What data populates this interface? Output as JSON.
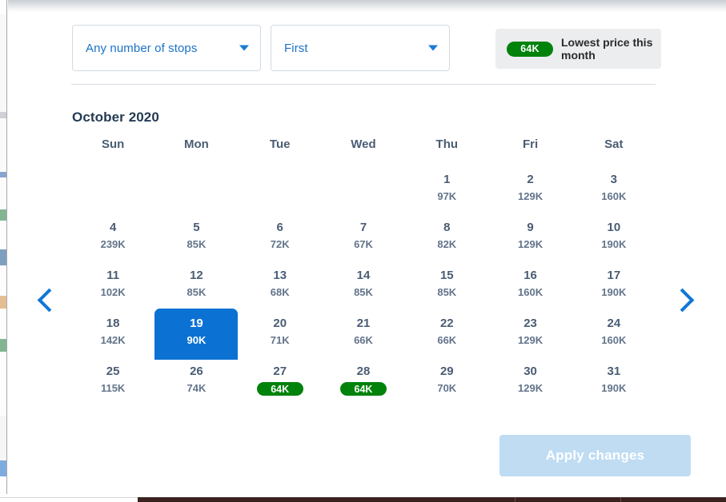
{
  "filters": {
    "stops": {
      "value": "Any number of stops",
      "caret_icon": "caret-down-icon"
    },
    "cabin": {
      "value": "First",
      "caret_icon": "caret-down-icon"
    }
  },
  "lowest_price": {
    "badge": "64K",
    "label": "Lowest price this month",
    "badge_color": "#00820b"
  },
  "calendar": {
    "month_title": "October 2020",
    "weekdays": [
      "Sun",
      "Mon",
      "Tue",
      "Wed",
      "Thu",
      "Fri",
      "Sat"
    ],
    "prev_icon": "chevron-left-icon",
    "next_icon": "chevron-right-icon",
    "selected_day": 19,
    "selected_color": "#0b72d4",
    "weeks": [
      [
        {
          "day": "",
          "price": "",
          "empty": true
        },
        {
          "day": "",
          "price": "",
          "empty": true
        },
        {
          "day": "",
          "price": "",
          "empty": true
        },
        {
          "day": "",
          "price": "",
          "empty": true
        },
        {
          "day": "1",
          "price": "97K"
        },
        {
          "day": "2",
          "price": "129K"
        },
        {
          "day": "3",
          "price": "160K"
        }
      ],
      [
        {
          "day": "4",
          "price": "239K"
        },
        {
          "day": "5",
          "price": "85K"
        },
        {
          "day": "6",
          "price": "72K"
        },
        {
          "day": "7",
          "price": "67K"
        },
        {
          "day": "8",
          "price": "82K"
        },
        {
          "day": "9",
          "price": "129K"
        },
        {
          "day": "10",
          "price": "190K"
        }
      ],
      [
        {
          "day": "11",
          "price": "102K"
        },
        {
          "day": "12",
          "price": "85K"
        },
        {
          "day": "13",
          "price": "68K"
        },
        {
          "day": "14",
          "price": "85K"
        },
        {
          "day": "15",
          "price": "85K"
        },
        {
          "day": "16",
          "price": "160K"
        },
        {
          "day": "17",
          "price": "190K"
        }
      ],
      [
        {
          "day": "18",
          "price": "142K"
        },
        {
          "day": "19",
          "price": "90K",
          "selected": true
        },
        {
          "day": "20",
          "price": "71K"
        },
        {
          "day": "21",
          "price": "66K"
        },
        {
          "day": "22",
          "price": "66K"
        },
        {
          "day": "23",
          "price": "129K"
        },
        {
          "day": "24",
          "price": "160K"
        }
      ],
      [
        {
          "day": "25",
          "price": "115K"
        },
        {
          "day": "26",
          "price": "74K"
        },
        {
          "day": "27",
          "price": "64K",
          "lowest": true
        },
        {
          "day": "28",
          "price": "64K",
          "lowest": true
        },
        {
          "day": "29",
          "price": "70K"
        },
        {
          "day": "30",
          "price": "129K"
        },
        {
          "day": "31",
          "price": "190K"
        }
      ]
    ]
  },
  "apply_button": {
    "label": "Apply changes",
    "disabled": true
  }
}
